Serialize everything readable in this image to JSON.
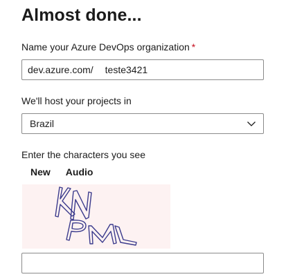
{
  "page": {
    "title": "Almost done..."
  },
  "org": {
    "label": "Name your Azure DevOps organization",
    "required_mark": "*",
    "prefix": "dev.azure.com/",
    "value": "teste3421"
  },
  "region": {
    "label": "We'll host your projects in",
    "selected": "Brazil",
    "icon": "chevron-down-icon"
  },
  "captcha": {
    "label": "Enter the characters you see",
    "new_label": "New",
    "audio_label": "Audio",
    "image_text": "KNPM",
    "input_value": "",
    "colors": {
      "background": "#fdf2f2",
      "stroke": "#3a3a8c"
    }
  },
  "colors": {
    "required": "#c50f1f",
    "border": "#8a8a8a",
    "text": "#1b1b1b"
  }
}
